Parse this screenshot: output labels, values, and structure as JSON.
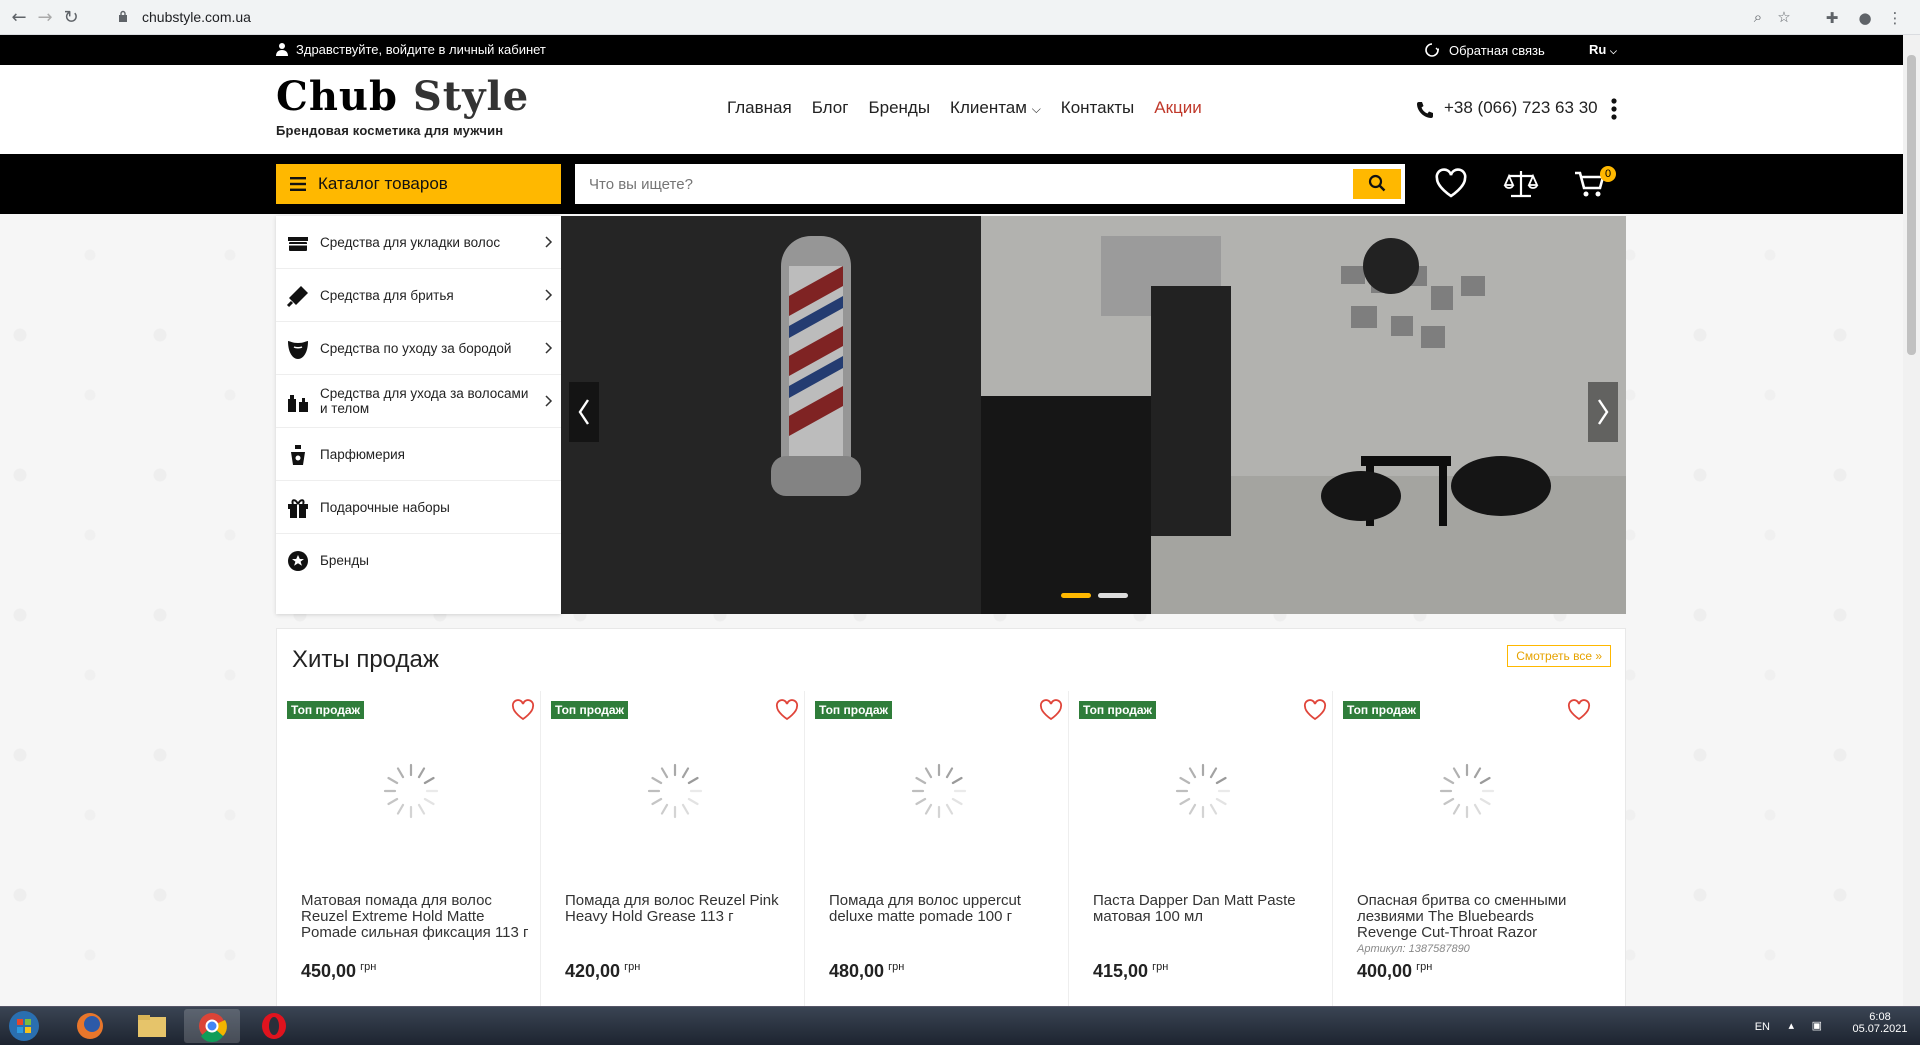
{
  "browser": {
    "url": "chubstyle.com.ua"
  },
  "topbar": {
    "greeting": "Здравствуйте, войдите в личный кабинет",
    "feedback": "Обратная связь",
    "language": "Ru"
  },
  "header": {
    "logo_part1": "Chub",
    "logo_part2": "Style",
    "tagline": "Брендовая косметика для мужчин",
    "nav": [
      {
        "label": "Главная"
      },
      {
        "label": "Блог"
      },
      {
        "label": "Бренды"
      },
      {
        "label": "Клиентам"
      },
      {
        "label": "Контакты"
      },
      {
        "label": "Акции"
      }
    ],
    "phone": "+38 (066) 723 63 30"
  },
  "navbar": {
    "catalog_label": "Каталог товаров",
    "search_placeholder": "Что вы ищете?",
    "cart_count": "0"
  },
  "categories": [
    {
      "label": "Средства для укладки волос",
      "icon": "hair-product-icon"
    },
    {
      "label": "Средства для бритья",
      "icon": "razor-icon"
    },
    {
      "label": "Средства по уходу за бородой",
      "icon": "beard-icon"
    },
    {
      "label": "Средства для ухода за волосами и телом",
      "icon": "bottles-icon"
    },
    {
      "label": "Парфюмерия",
      "icon": "perfume-icon"
    },
    {
      "label": "Подарочные наборы",
      "icon": "gift-icon"
    },
    {
      "label": "Бренды",
      "icon": "brands-icon"
    }
  ],
  "products": {
    "title": "Хиты продаж",
    "see_all": "Смотреть все »",
    "items": [
      {
        "badge": "Топ продаж",
        "name": "Матовая помада для волос Reuzel Extreme Hold Matte Pomade сильная фиксация 113 г",
        "price": "450,00",
        "currency": "грн",
        "sku": ""
      },
      {
        "badge": "Топ продаж",
        "name": "Помада для волос Reuzel Pink Heavy Hold Grease 113 г",
        "price": "420,00",
        "currency": "грн",
        "sku": ""
      },
      {
        "badge": "Топ продаж",
        "name": "Помада для волос uppercut deluxe matte pomade 100 г",
        "price": "480,00",
        "currency": "грн",
        "sku": ""
      },
      {
        "badge": "Топ продаж",
        "name": "Паста Dapper Dan Matt Paste матовая 100 мл",
        "price": "415,00",
        "currency": "грн",
        "sku": ""
      },
      {
        "badge": "Топ продаж",
        "name": "Опасная бритва со сменными лезвиями The Bluebeards Revenge Cut-Throat Razor",
        "price": "400,00",
        "currency": "грн",
        "sku": "Артикул: 1387587890"
      }
    ]
  },
  "taskbar": {
    "lang": "EN",
    "time": "6:08",
    "date": "05.07.2021"
  },
  "colors": {
    "accent": "#ffb800",
    "badge": "#2f7d3a",
    "sale_link": "#c0392b"
  }
}
